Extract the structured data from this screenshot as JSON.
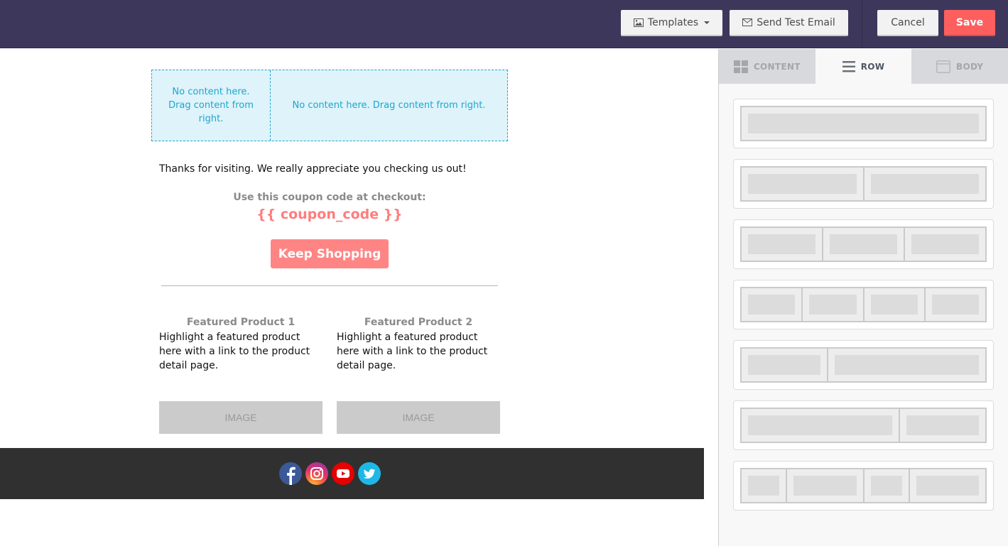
{
  "toolbar": {
    "templates_label": "Templates",
    "send_test_label": "Send Test Email",
    "cancel_label": "Cancel",
    "save_label": "Save",
    "colors": {
      "bar": "#3e375c",
      "save": "#fd5f5f"
    }
  },
  "email": {
    "dropzone": {
      "left_text": "No content here. Drag content from right.",
      "right_text": "No content here. Drag content from right."
    },
    "thanks_text": "Thanks for visiting. We really appreciate you checking us out!",
    "coupon_label": "Use this coupon code at checkout:",
    "coupon_code": "{{ coupon_code }}",
    "cta_label": "Keep Shopping",
    "products": [
      {
        "title": "Featured Product 1",
        "description": "Highlight a featured product here with a link to the product detail page.",
        "image_label": "IMAGE"
      },
      {
        "title": "Featured Product 2",
        "description": "Highlight a featured product here with a link to the product detail page.",
        "image_label": "IMAGE"
      }
    ],
    "social_icons": [
      "facebook-icon",
      "instagram-icon",
      "youtube-icon",
      "twitter-icon"
    ]
  },
  "panel": {
    "tabs": [
      {
        "label": "CONTENT",
        "icon": "grid-icon",
        "active": false
      },
      {
        "label": "ROW",
        "icon": "rows-icon",
        "active": true
      },
      {
        "label": "BODY",
        "icon": "body-icon",
        "active": false
      }
    ],
    "row_layouts": [
      {
        "name": "1-column",
        "columns": [
          12
        ]
      },
      {
        "name": "2-columns",
        "columns": [
          6,
          6
        ]
      },
      {
        "name": "3-columns",
        "columns": [
          4,
          4,
          4
        ]
      },
      {
        "name": "4-columns",
        "columns": [
          3,
          3,
          3,
          3
        ]
      },
      {
        "name": "1/3-2/3",
        "columns": [
          4,
          8
        ]
      },
      {
        "name": "2/3-1/3",
        "columns": [
          8,
          4
        ]
      },
      {
        "name": "mixed-4",
        "columns": [
          2,
          4,
          2,
          4
        ]
      }
    ]
  }
}
